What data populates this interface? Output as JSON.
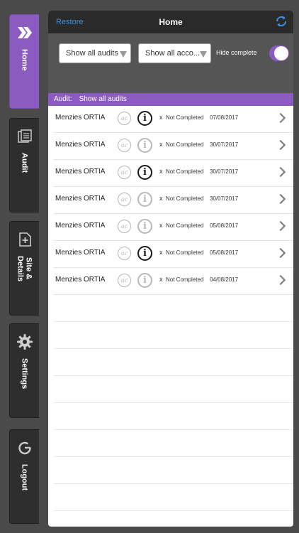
{
  "sidebar": {
    "items": [
      {
        "label": "Home",
        "icon": "home-arrow-icon",
        "active": true
      },
      {
        "label": "Audit",
        "icon": "audit-grid-icon",
        "active": false
      },
      {
        "label": "Site &\nDetails",
        "icon": "site-details-icon",
        "active": false
      },
      {
        "label": "Settings",
        "icon": "gear-icon",
        "active": false
      },
      {
        "label": "Logout",
        "icon": "power-icon",
        "active": false
      }
    ]
  },
  "topbar": {
    "restore_label": "Restore",
    "title": "Home"
  },
  "filters": {
    "audit_filter": "Show all audits",
    "account_filter": "Show all acco...",
    "hide_complete_label": "Hide complete",
    "hide_complete_on": true
  },
  "audit_header": {
    "label": "Audit:",
    "value": "Show all audits"
  },
  "rows": [
    {
      "name": "Menzies ORTIA",
      "ac": "ac",
      "info": "i",
      "info_dark": true,
      "x": "x",
      "status": "Not Completed",
      "date": "07/08/2017"
    },
    {
      "name": "Menzies ORTIA",
      "ac": "ac",
      "info": "i",
      "info_dark": false,
      "x": "x",
      "status": "Not Completed",
      "date": "30/07/2017"
    },
    {
      "name": "Menzies ORTIA",
      "ac": "ac",
      "info": "i",
      "info_dark": true,
      "x": "x",
      "status": "Not Completed",
      "date": "30/07/2017"
    },
    {
      "name": "Menzies ORTIA",
      "ac": "ac",
      "info": "i",
      "info_dark": false,
      "x": "x",
      "status": "Not Completed",
      "date": "30/07/2017"
    },
    {
      "name": "Menzies ORTIA",
      "ac": "ac",
      "info": "i",
      "info_dark": false,
      "x": "x",
      "status": "Not Completed",
      "date": "05/08/2017"
    },
    {
      "name": "Menzies ORTIA",
      "ac": "ac",
      "info": "i",
      "info_dark": true,
      "x": "x",
      "status": "Not Completed",
      "date": "05/08/2017"
    },
    {
      "name": "Menzies ORTIA",
      "ac": "ac",
      "info": "i",
      "info_dark": false,
      "x": "x",
      "status": "Not Completed",
      "date": "04/08/2017"
    }
  ],
  "colors": {
    "accent": "#8c5bc2",
    "link": "#3b8fe0",
    "dark_bar": "#2a2a2a",
    "filter_bar": "#555555"
  }
}
